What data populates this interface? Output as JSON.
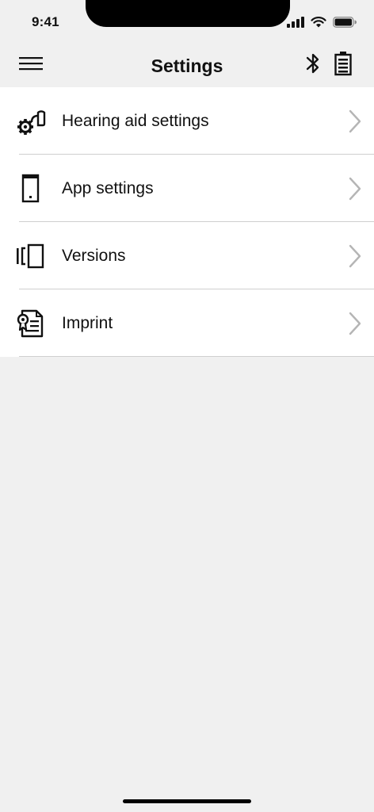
{
  "status_bar": {
    "time": "9:41",
    "icons": [
      "signal-icon",
      "wifi-icon",
      "battery-icon"
    ]
  },
  "header": {
    "title": "Settings",
    "left_icon": "hamburger-menu-icon",
    "right_icons": [
      "bluetooth-icon",
      "device-battery-icon"
    ]
  },
  "settings_list": {
    "items": [
      {
        "label": "Hearing aid settings",
        "icon": "hearing-aid-gear-icon"
      },
      {
        "label": "App settings",
        "icon": "phone-icon"
      },
      {
        "label": "Versions",
        "icon": "versions-icon"
      },
      {
        "label": "Imprint",
        "icon": "imprint-document-icon"
      }
    ],
    "chevron_icon": "chevron-right-icon"
  },
  "colors": {
    "background": "#f0f0f0",
    "list_background": "#ffffff",
    "separator": "#cfcfcf",
    "chevron": "#b5b5b5",
    "text": "#111111"
  }
}
